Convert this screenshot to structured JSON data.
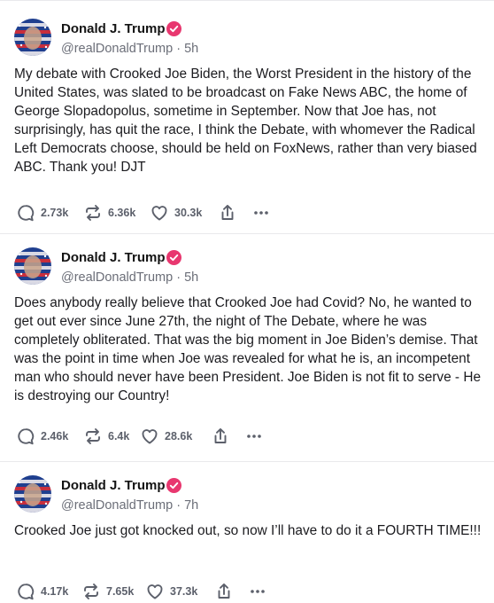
{
  "posts": [
    {
      "author_name": "Donald J. Trump",
      "handle": "@realDonaldTrump",
      "separator": " · ",
      "time": "5h",
      "text": "My debate with Crooked Joe Biden, the Worst President in the history of the United States, was slated to be broadcast on Fake News ABC, the home of George Slopadopolus, sometime in September. Now that Joe has, not surprisingly, has quit the race, I think the Debate, with whomever the Radical Left Democrats choose, should be held on FoxNews, rather than very biased ABC. Thank you! DJT",
      "replies": "2.73k",
      "retruths": "6.36k",
      "likes": "30.3k"
    },
    {
      "author_name": "Donald J. Trump",
      "handle": "@realDonaldTrump",
      "separator": " · ",
      "time": "5h",
      "text": "Does anybody really believe that Crooked Joe had Covid? No, he wanted to get out ever since June 27th, the night of The Debate, where he was completely obliterated. That was the big moment in Joe Biden’s demise. That was the point in time when Joe was revealed for what he is, an incompetent man who should never have been President. Joe Biden is not fit to serve - He is destroying our Country!",
      "replies": "2.46k",
      "retruths": "6.4k",
      "likes": "28.6k"
    },
    {
      "author_name": "Donald J. Trump",
      "handle": "@realDonaldTrump",
      "separator": " · ",
      "time": "7h",
      "text": "Crooked Joe just got knocked out, so now I’ll have to do it a FOURTH TIME!!!",
      "replies": "4.17k",
      "retruths": "7.65k",
      "likes": "37.3k"
    }
  ],
  "icons": {
    "reply": "speech-bubble-icon",
    "retruth": "repost-arrows-icon",
    "like": "heart-icon",
    "share": "share-upload-icon",
    "more": "more-dots-icon",
    "verified": "verified-badge-icon"
  },
  "colors": {
    "verified": "#e8376f",
    "muted": "#6b6e78",
    "separator": "#e9e9ec"
  }
}
